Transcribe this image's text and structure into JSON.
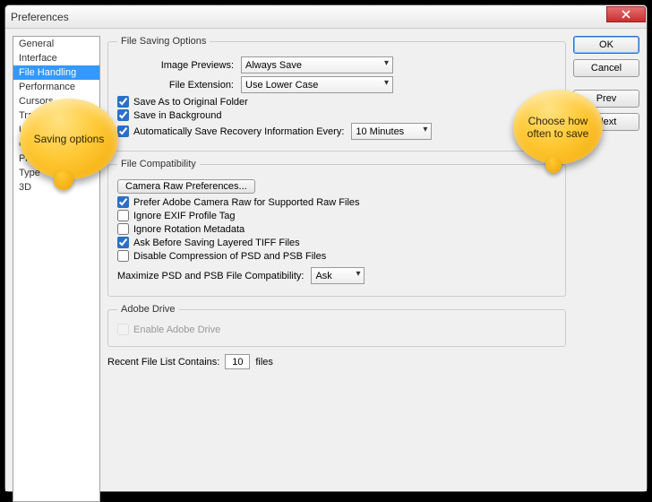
{
  "window": {
    "title": "Preferences"
  },
  "sidebar": {
    "items": [
      {
        "label": "General"
      },
      {
        "label": "Interface"
      },
      {
        "label": "File Handling",
        "selected": true
      },
      {
        "label": "Performance"
      },
      {
        "label": "Cursors"
      },
      {
        "label": "Transparency"
      },
      {
        "label": "Units"
      },
      {
        "label": "Guides"
      },
      {
        "label": "Plug-Ins"
      },
      {
        "label": "Type"
      },
      {
        "label": "3D"
      }
    ]
  },
  "buttons": {
    "ok": "OK",
    "cancel": "Cancel",
    "prev": "Prev",
    "next": "Next"
  },
  "fso": {
    "legend": "File Saving Options",
    "image_previews_label": "Image Previews:",
    "image_previews_value": "Always Save",
    "file_extension_label": "File Extension:",
    "file_extension_value": "Use Lower Case",
    "save_original": "Save As to Original Folder",
    "save_bg": "Save in Background",
    "auto_save": "Automatically Save Recovery Information Every:",
    "auto_save_value": "10 Minutes"
  },
  "fc": {
    "legend": "File Compatibility",
    "camera_raw": "Camera Raw Preferences...",
    "prefer_acr": "Prefer Adobe Camera Raw for Supported Raw Files",
    "ignore_exif": "Ignore EXIF Profile Tag",
    "ignore_rot": "Ignore Rotation Metadata",
    "ask_tiff": "Ask Before Saving Layered TIFF Files",
    "disable_comp": "Disable Compression of PSD and PSB Files",
    "max_compat_label": "Maximize PSD and PSB File Compatibility:",
    "max_compat_value": "Ask"
  },
  "ad": {
    "legend": "Adobe Drive",
    "enable": "Enable Adobe Drive"
  },
  "recent": {
    "label": "Recent File List Contains:",
    "value": "10",
    "suffix": "files"
  },
  "bubbles": {
    "left": "Saving options",
    "right": "Choose how often to save"
  }
}
